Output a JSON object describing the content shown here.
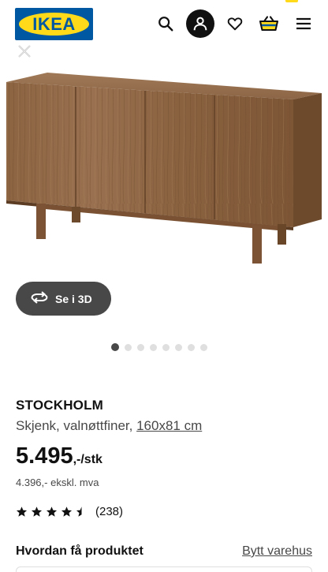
{
  "header": {
    "logo_text": "IKEA",
    "icons": [
      "search-icon",
      "account-icon",
      "heart-icon",
      "basket-icon",
      "menu-icon"
    ]
  },
  "gallery": {
    "view_3d_label": "Se i 3D",
    "dot_count": 8,
    "active_dot": 0
  },
  "product": {
    "name": "STOCKHOLM",
    "description": "Skjenk, valnøttfiner,",
    "size": "160x81 cm",
    "price_main": "5.495",
    "price_suffix": ",-/stk",
    "price_ex_vat": "4.396,- ekskl. mva",
    "rating": 4.5,
    "rating_count": "(238)"
  },
  "availability": {
    "title": "Hvordan få produktet",
    "change_store_link": "Bytt varehus"
  },
  "colors": {
    "ikea_blue": "#0058a3",
    "ikea_yellow": "#ffda1a",
    "walnut": "#8a6240",
    "dark_button": "#484848"
  }
}
